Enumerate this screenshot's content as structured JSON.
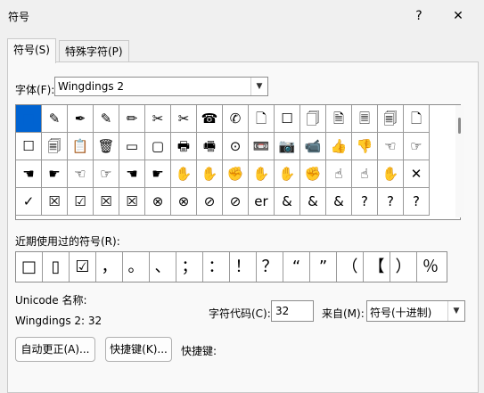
{
  "window": {
    "title": "符号",
    "help": "?",
    "close": "✕"
  },
  "tabs": [
    {
      "label": "符号(S)"
    },
    {
      "label": "特殊字符(P)"
    }
  ],
  "font": {
    "label": "字体(F):",
    "value": "Wingdings 2"
  },
  "symbols": [
    [
      "■",
      "✎",
      "✒",
      "✎",
      "✏",
      "✂",
      "✂",
      "☎",
      "✆",
      "🗋",
      "☐",
      "🗍",
      "🗎",
      "🗏",
      "🗐",
      "🗋"
    ],
    [
      "☐",
      "🗐",
      "📋",
      "🗑",
      "▭",
      "▢",
      "🖶",
      "🖷",
      "⊙",
      "📼",
      "📷",
      "📹",
      "👍",
      "👎",
      "☜",
      "☞"
    ],
    [
      "☚",
      "☛",
      "☜",
      "☞",
      "☚",
      "☛",
      "✋",
      "✋",
      "✊",
      "✋",
      "✋",
      "✊",
      "☝",
      "☝",
      "✋",
      "✕"
    ],
    [
      "✓",
      "☒",
      "☑",
      "☒",
      "☒",
      "⊗",
      "⊗",
      "⊘",
      "⊘",
      "er",
      "&",
      "&",
      "&",
      "?",
      "?",
      "?"
    ]
  ],
  "recent": {
    "label": "近期使用过的符号(R):",
    "items": [
      "□",
      "▯",
      "☑",
      "，",
      "。",
      "、",
      "；",
      "：",
      "！",
      "？",
      "“",
      "”",
      "（",
      "【",
      "）",
      "％"
    ]
  },
  "unicode": {
    "name_label": "Unicode 名称:",
    "name_value": "Wingdings 2: 32"
  },
  "charcode": {
    "label": "字符代码(C):",
    "value": "32"
  },
  "from": {
    "label": "来自(M):",
    "value": "符号(十进制)"
  },
  "buttons": {
    "autocorrect": "自动更正(A)...",
    "shortcut_key": "快捷键(K)...",
    "shortcut_label": "快捷键:"
  },
  "colors": {
    "selection": "#0063d1"
  }
}
